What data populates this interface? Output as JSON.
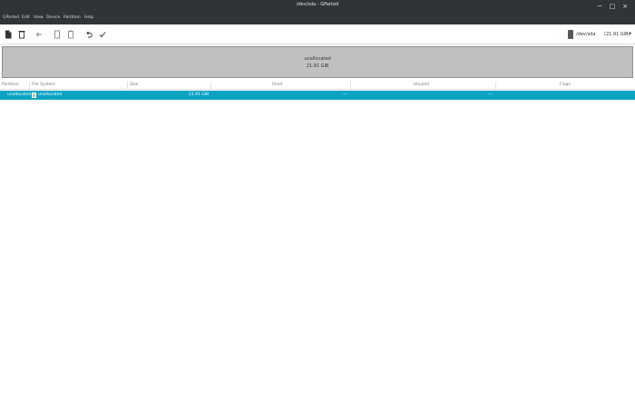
{
  "window": {
    "title": "/dev/sda - GParted",
    "minimize_glyph": "─",
    "maximize_glyph": "□",
    "close_glyph": "×"
  },
  "menu": {
    "items": [
      "GParted",
      "Edit",
      "View",
      "Device",
      "Partition",
      "Help"
    ]
  },
  "toolbar": {
    "buttons": [
      "new-icon",
      "delete-icon",
      "resize-move-icon",
      "copy-icon",
      "paste-icon",
      "undo-icon",
      "apply-icon"
    ],
    "device_name": "/dev/sda",
    "device_size": "(21.91 GiB)",
    "device_arrow": "▸"
  },
  "disk_map": {
    "label": "unallocated",
    "size": "21.91 GiB",
    "color": "#c0c0c0"
  },
  "table": {
    "headers": [
      "Partition",
      "File System",
      "Size",
      "Used",
      "Unused",
      "Flags"
    ],
    "rows": [
      {
        "partition": "unallocated",
        "filesystem": "unallocated",
        "size": "21.91 GiB",
        "used": "---",
        "unused": "---",
        "flags": ""
      }
    ]
  },
  "colors": {
    "selection": "#0aa3c2",
    "titlebar": "#2f3437"
  }
}
